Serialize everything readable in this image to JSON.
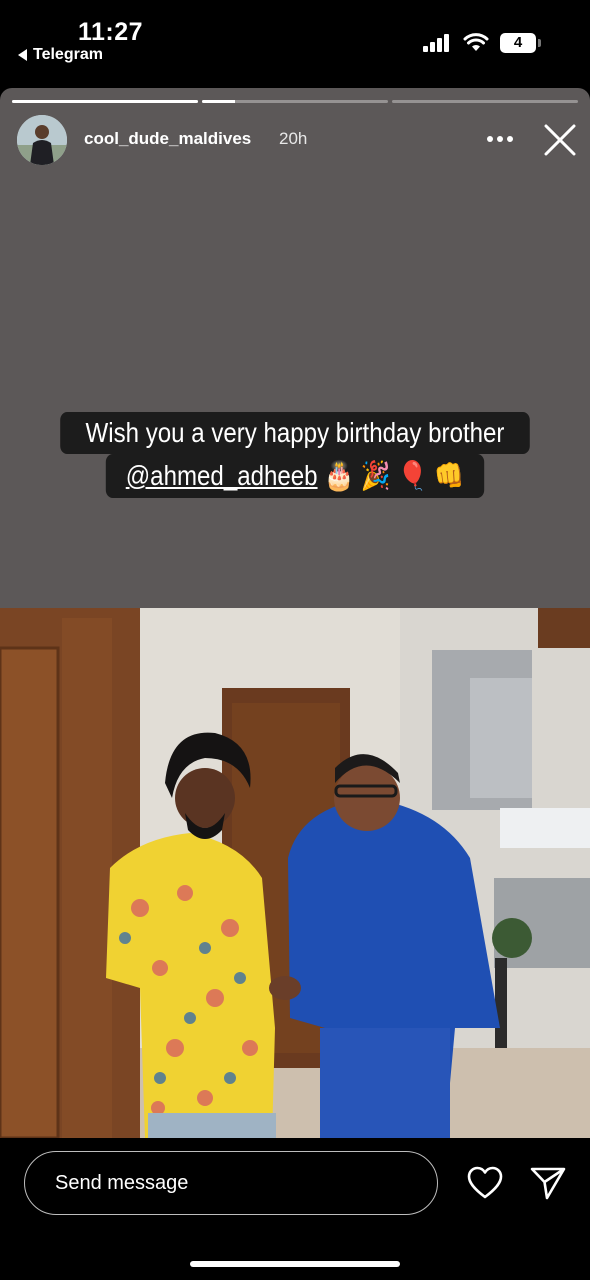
{
  "status_bar": {
    "time": "11:27",
    "back_app": "Telegram",
    "battery": "4"
  },
  "story": {
    "username": "cool_dude_maldives",
    "age": "20h",
    "segments": [
      {
        "progress": 1.0
      },
      {
        "progress": 0.18
      },
      {
        "progress": 0.0
      }
    ],
    "background_color": "#5c5858",
    "caption_line1": "Wish you a very happy birthday brother",
    "caption_mention": "@ahmed_adheeb",
    "caption_emojis": "🎂 🎉 🎈 👊"
  },
  "icons": {
    "more": "more-options-icon",
    "close": "close-icon",
    "like": "heart-icon",
    "share": "send-icon"
  },
  "footer": {
    "message_placeholder": "Send message"
  }
}
